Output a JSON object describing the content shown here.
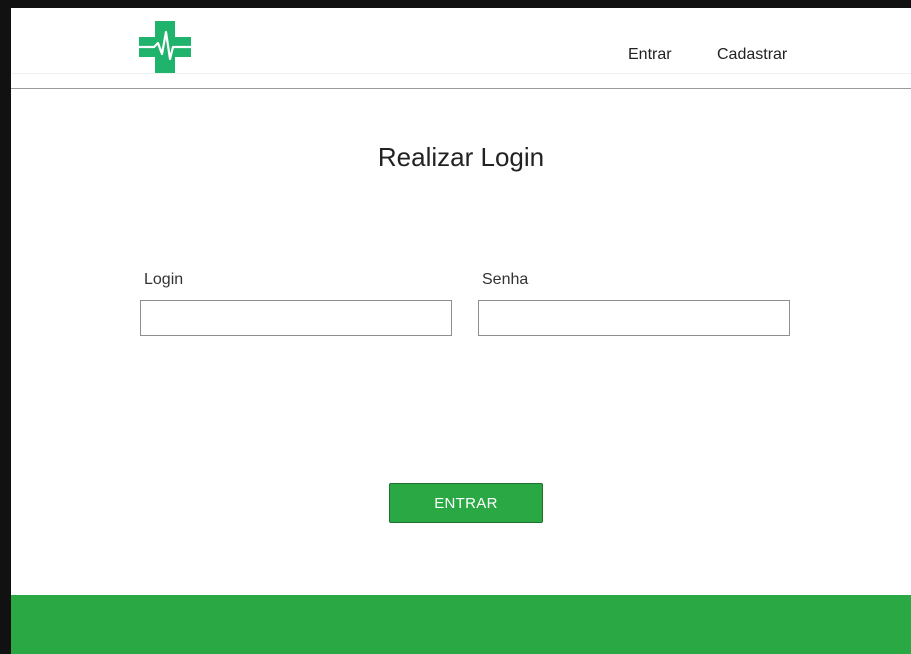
{
  "header": {
    "logo_icon": "medical-cross-heartbeat-icon",
    "nav": {
      "login_label": "Entrar",
      "register_label": "Cadastrar"
    }
  },
  "main": {
    "title": "Realizar Login",
    "fields": {
      "login": {
        "label": "Login",
        "value": "",
        "placeholder": ""
      },
      "password": {
        "label": "Senha",
        "value": "",
        "placeholder": ""
      }
    },
    "submit_label": "ENTRAR"
  },
  "colors": {
    "brand_green": "#2aa844",
    "logo_green": "#1fb36b",
    "border_gray": "#8e8e8e"
  }
}
